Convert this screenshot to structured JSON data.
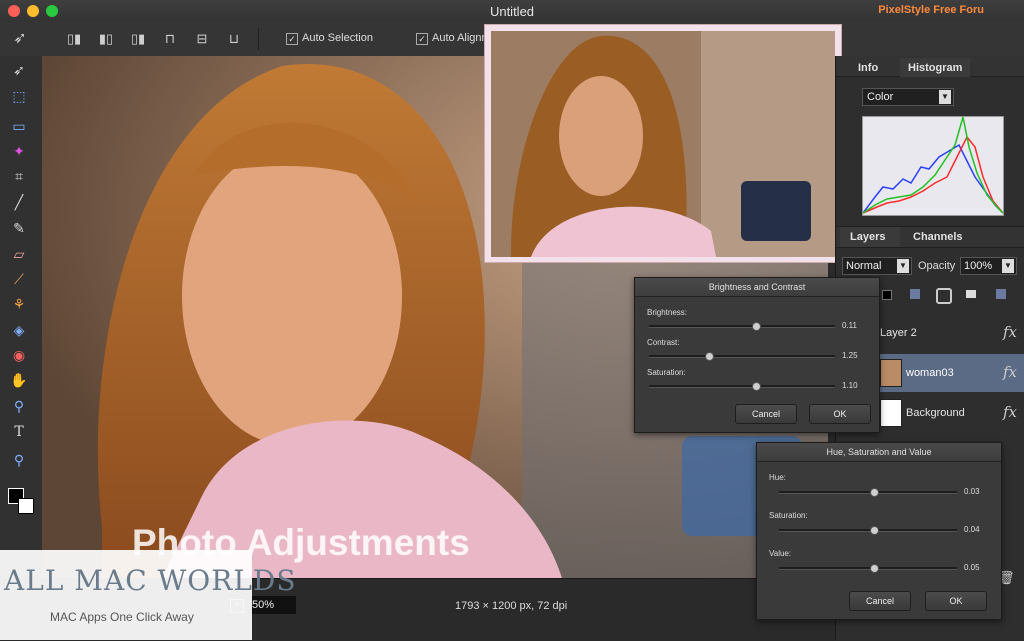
{
  "window": {
    "title": "Untitled",
    "brand_tag": "PixelStyle Free Foru"
  },
  "toolbar": {
    "auto_selection_label": "Auto Selection",
    "auto_align_label": "Auto Alignm",
    "auto_selection_checked": "✓",
    "auto_align_checked": "✓"
  },
  "canvas": {
    "overlay_text": "Photo Adjustments"
  },
  "status": {
    "zoom": "50%",
    "dimensions": "1793 × 1200 px, 72 dpi"
  },
  "watermark": {
    "brand": "ALL MAC WORLDS",
    "tagline": "MAC Apps One Click Away"
  },
  "sidebar": {
    "tabs_top": [
      "Info",
      "Histogram"
    ],
    "histogram_mode": "Color",
    "tabs_layers": [
      "Layers",
      "Channels"
    ],
    "blend_mode": "Normal",
    "opacity_label": "Opacity",
    "opacity_value": "100%",
    "layers": [
      {
        "name": "Layer 2",
        "fx": "fx"
      },
      {
        "name": "woman03",
        "fx": "fx"
      },
      {
        "name": "Background",
        "fx": "fx"
      }
    ]
  },
  "brightness_contrast": {
    "title": "Brightness and Contrast",
    "sliders": [
      {
        "label": "Brightness:",
        "value": "0.11",
        "level": 0.55
      },
      {
        "label": "Contrast:",
        "value": "1.25",
        "level": 0.3
      },
      {
        "label": "Saturation:",
        "value": "1.10",
        "level": 0.55
      }
    ],
    "cancel": "Cancel",
    "ok": "OK"
  },
  "hue_saturation": {
    "title": "Hue, Saturation and Value",
    "sliders": [
      {
        "label": "Hue:",
        "value": "0.03",
        "level": 0.52
      },
      {
        "label": "Saturation:",
        "value": "0.04",
        "level": 0.52
      },
      {
        "label": "Value:",
        "value": "0.05",
        "level": 0.52
      }
    ],
    "cancel": "Cancel",
    "ok": "OK"
  },
  "colors": {
    "accent": "#ff8a3d",
    "selected_layer": "#5b6a85"
  }
}
